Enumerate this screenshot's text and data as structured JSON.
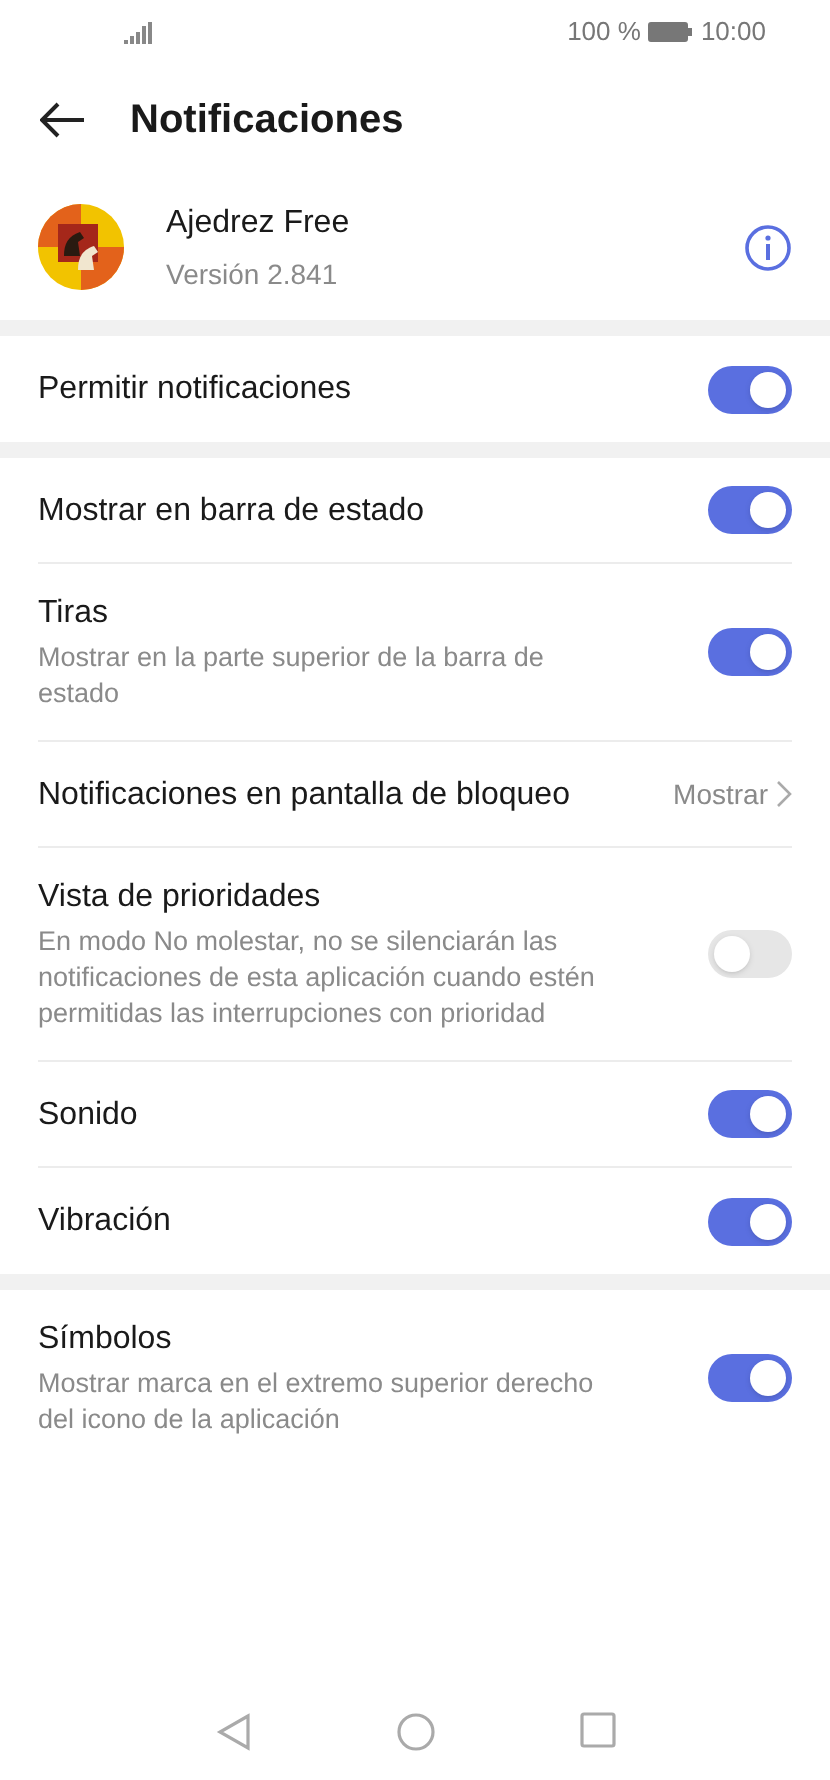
{
  "status_bar": {
    "battery": "100 %",
    "time": "10:00"
  },
  "header": {
    "title": "Notificaciones"
  },
  "app": {
    "name": "Ajedrez Free",
    "version": "Versión 2.841"
  },
  "sections": [
    {
      "items": [
        {
          "kind": "toggle",
          "title": "Permitir notificaciones",
          "on": true
        }
      ]
    },
    {
      "items": [
        {
          "kind": "toggle",
          "title": "Mostrar en barra de estado",
          "on": true
        },
        {
          "kind": "toggle",
          "title": "Tiras",
          "description": "Mostrar en la parte superior de la barra de estado",
          "on": true
        },
        {
          "kind": "value",
          "title": "Notificaciones en pantalla de bloqueo",
          "value": "Mostrar"
        },
        {
          "kind": "toggle",
          "title": "Vista de prioridades",
          "description": "En modo No molestar, no se silenciarán las notificaciones de esta aplicación cuando estén permitidas las interrupciones con prioridad",
          "on": false
        },
        {
          "kind": "toggle",
          "title": "Sonido",
          "on": true
        },
        {
          "kind": "toggle",
          "title": "Vibración",
          "on": true
        }
      ]
    },
    {
      "items": [
        {
          "kind": "toggle",
          "title": "Símbolos",
          "description": "Mostrar marca en el extremo superior derecho del icono de la aplicación",
          "on": true
        }
      ]
    }
  ]
}
